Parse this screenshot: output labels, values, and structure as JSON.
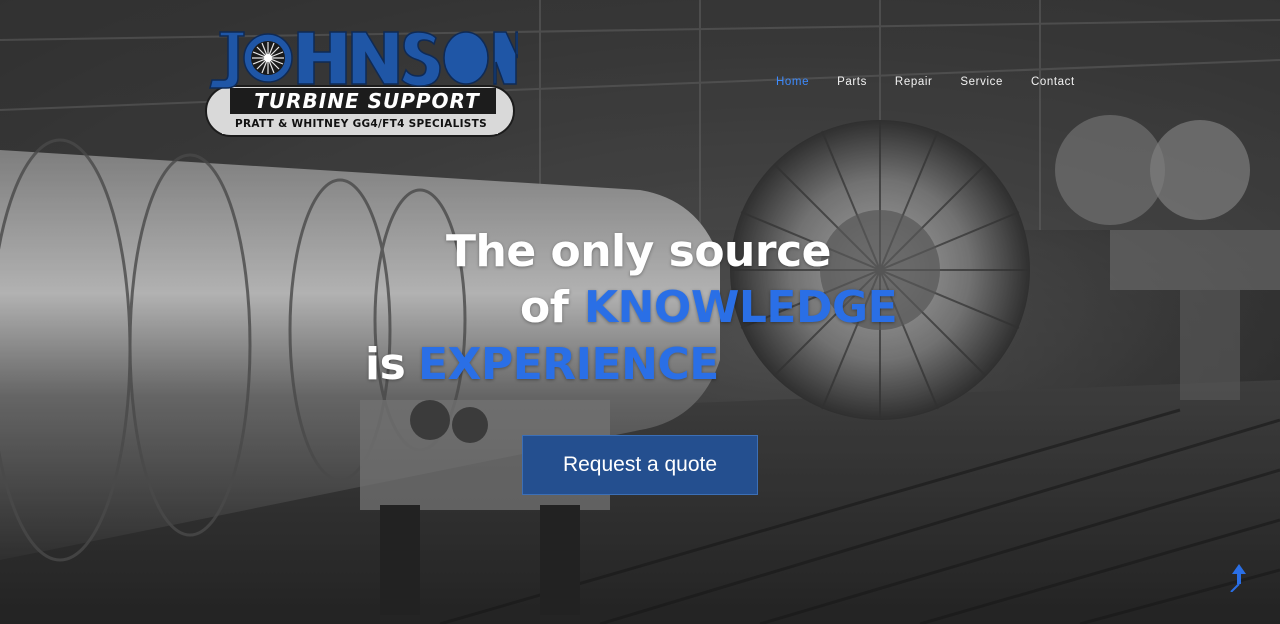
{
  "logo": {
    "name": "JOHNSON",
    "tagline": "TURBINE SUPPORT",
    "subtitle": "PRATT & WHITNEY GG4/FT4 SPECIALISTS"
  },
  "nav": {
    "items": [
      "Home",
      "Parts",
      "Repair",
      "Service",
      "Contact"
    ],
    "active": "Home"
  },
  "hero": {
    "line1": "The only source",
    "line2_prefix": "of",
    "line2_highlight": "KNOWLEDGE",
    "line3_prefix": "is",
    "line3_highlight": "EXPERIENCE"
  },
  "cta": {
    "label": "Request a quote"
  },
  "scroll_up": {
    "icon": "arrow-up-icon"
  },
  "colors": {
    "accent_blue": "#2a6fe6",
    "nav_active": "#3d8bff",
    "button_bg": "#244f8f",
    "logo_blue": "#1f56a6"
  }
}
